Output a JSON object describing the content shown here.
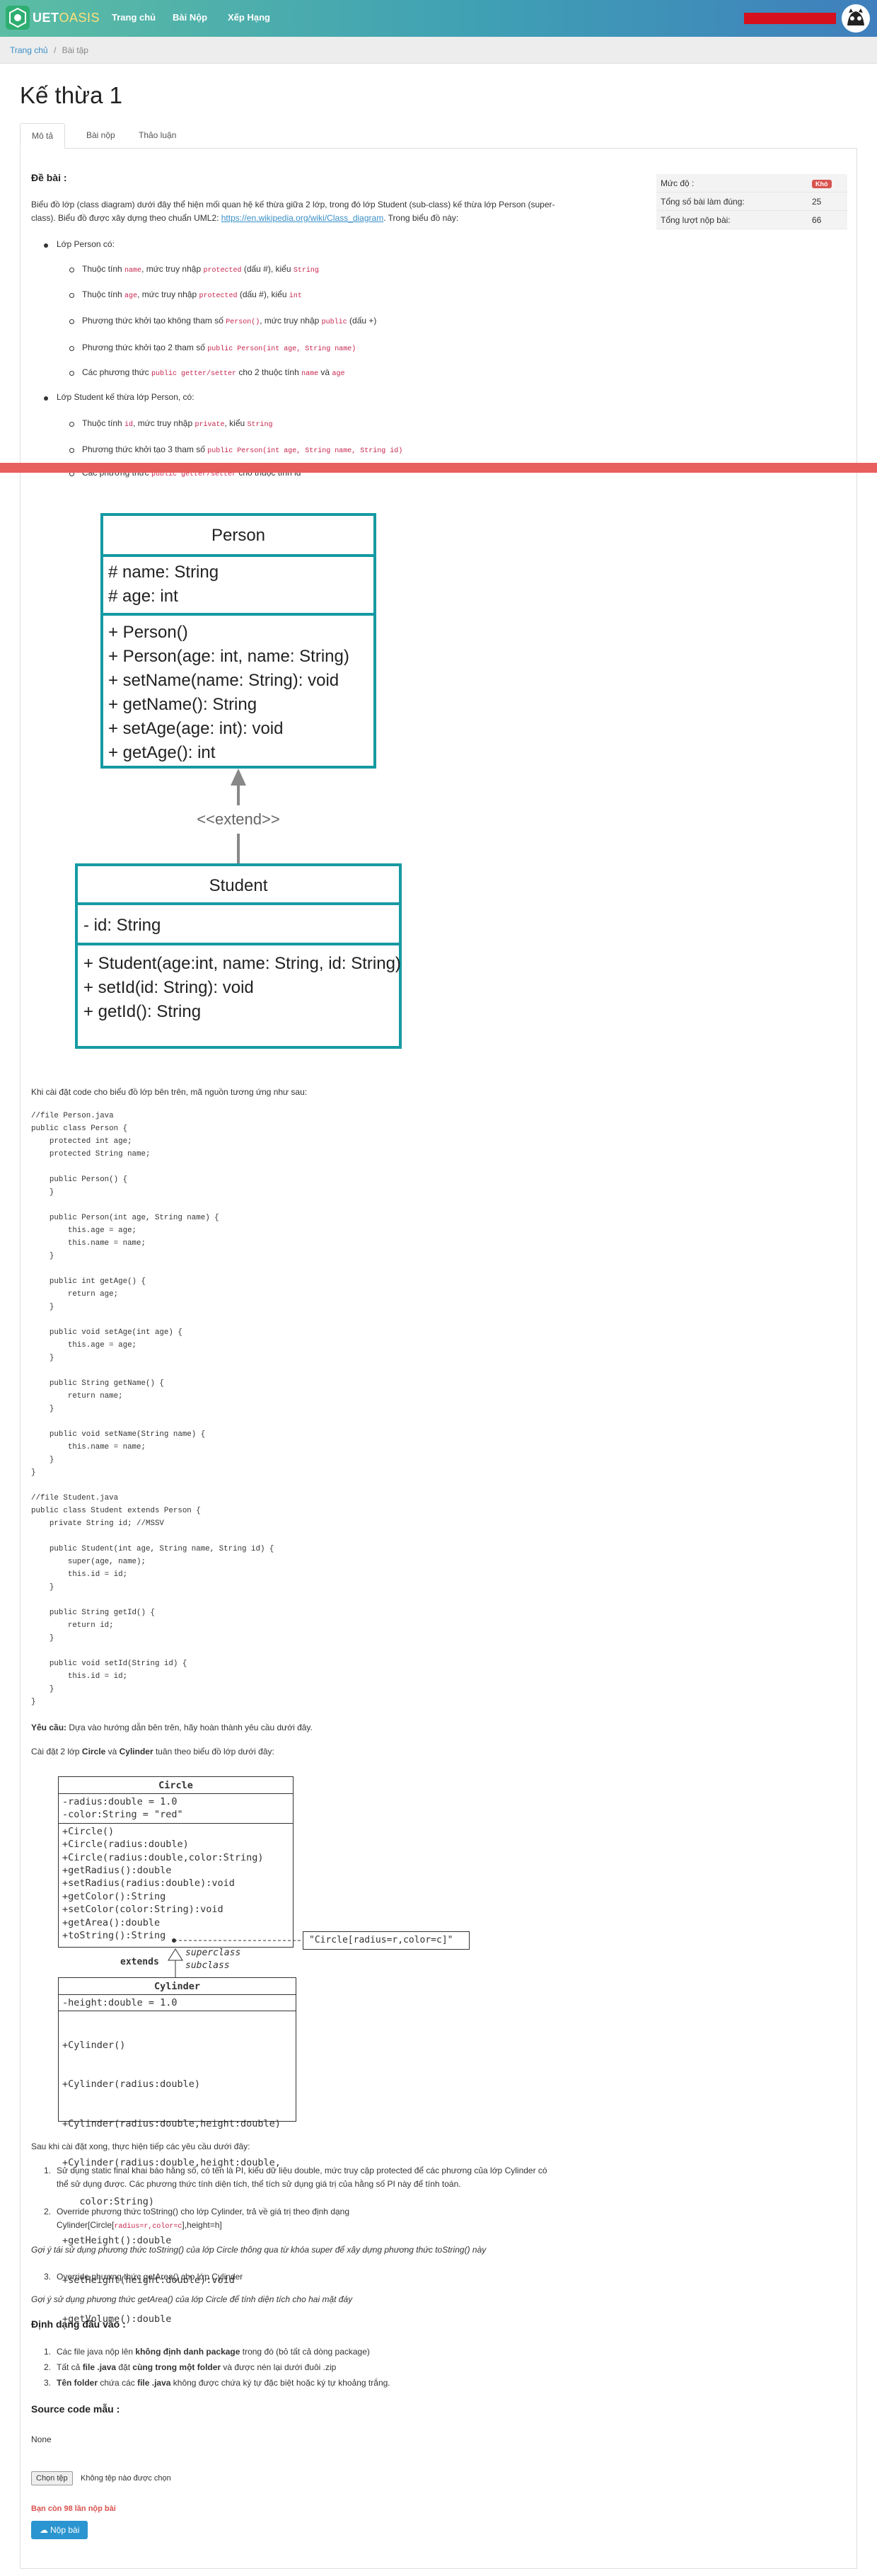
{
  "header": {
    "brand_a": "UET",
    "brand_b": "OASIS",
    "nav": [
      "Trang chủ",
      "Bài Nộp",
      "Xếp Hạng"
    ]
  },
  "breadcrumb": {
    "home": "Trang chủ",
    "sep": "/",
    "current": "Bài tập"
  },
  "page_title": "Kế thừa 1",
  "tabs": [
    "Mô tả",
    "Bài nộp",
    "Thảo luận"
  ],
  "info": {
    "rows": [
      {
        "label": "Mức độ :",
        "value": "Khó"
      },
      {
        "label": "Tổng số bài làm đúng:",
        "value": "25"
      },
      {
        "label": "Tổng lượt nộp bài:",
        "value": "66"
      }
    ]
  },
  "content": {
    "heading": "Đề bài :",
    "intro_a": "Biểu đồ lớp (class diagram) dưới đây thể hiện mối quan hệ kế thừa giữa 2 lớp, trong đó lớp Student (sub-class) kế thừa lớp Person (super-",
    "intro_b": "class). Biểu đồ được xây dựng theo chuẩn UML2:",
    "intro_link": "https://en.wikipedia.org/wiki/Class_diagram",
    "intro_c": ". Trong biểu đồ này:",
    "person_title": "Lớp Person có:",
    "p1_a": "Thuộc tính ",
    "p1_code1": "name",
    "p1_b": ", mức truy nhập ",
    "p1_code2": "protected",
    "p1_c": " (dấu #), kiểu ",
    "p1_code3": "String",
    "p2_a": "Thuộc tính ",
    "p2_code1": "age",
    "p2_b": ", mức truy nhập ",
    "p2_code2": "protected",
    "p2_c": " (dấu #), kiểu ",
    "p2_code3": "int",
    "p3_a": "Phương thức khởi tạo không tham số ",
    "p3_code1": "Person()",
    "p3_b": ", mức truy nhập ",
    "p3_code2": "public",
    "p3_c": " (dấu +)",
    "p4_a": "Phương thức khởi tạo 2 tham số ",
    "p4_code1": "public Person(int age, String name)",
    "p5_a": "Các phương thức ",
    "p5_code1": "public getter/setter",
    "p5_b": " cho 2 thuộc tính ",
    "p5_code2": "name",
    "p5_c": " và ",
    "p5_code3": "age",
    "student_title": "Lớp Student kế thừa lớp Person, có:",
    "s1_a": "Thuộc tính ",
    "s1_code1": "id",
    "s1_b": ", mức truy nhập ",
    "s1_code2": "private",
    "s1_c": ", kiểu ",
    "s1_code3": "String",
    "s2_a": "Phương thức khởi tạo 3 tham số ",
    "s2_code1": "public Person(int age, String name, String id)",
    "s3_a": "Các phương thức ",
    "s3_code1": "public getter/setter",
    "s3_b": " cho thuộc tính id"
  },
  "uml1": {
    "person": {
      "name": "Person",
      "attrs": [
        "# name: String",
        "# age: int"
      ],
      "methods": [
        "+ Person()",
        "+ Person(age: int, name: String)",
        "+ setName(name: String): void",
        "+ getName(): String",
        "+ setAge(age: int): void",
        "+ getAge(): int"
      ]
    },
    "extend": "<<extend>>",
    "student": {
      "name": "Student",
      "attrs": [
        "- id: String"
      ],
      "methods": [
        "+ Student(age:int, name: String, id: String)",
        "+ setId(id: String): void",
        "+ getId(): String"
      ]
    }
  },
  "code_intro": "Khi cài đặt code cho biểu đồ lớp bên trên, mã nguồn tương ứng như sau:",
  "source_code": "//file Person.java\npublic class Person {\n    protected int age;\n    protected String name;\n\n    public Person() {\n    }\n\n    public Person(int age, String name) {\n        this.age = age;\n        this.name = name;\n    }\n\n    public int getAge() {\n        return age;\n    }\n\n    public void setAge(int age) {\n        this.age = age;\n    }\n\n    public String getName() {\n        return name;\n    }\n\n    public void setName(String name) {\n        this.name = name;\n    }\n}\n\n//file Student.java\npublic class Student extends Person {\n    private String id; //MSSV\n\n    public Student(int age, String name, String id) {\n        super(age, name);\n        this.id = id;\n    }\n\n    public String getId() {\n        return id;\n    }\n\n    public void setId(String id) {\n        this.id = id;\n    }\n}",
  "req": {
    "label": "Yêu cầu:",
    "text": " Dựa vào hướng dẫn bên trên, hãy hoàn thành yêu cầu dưới đây.",
    "l2_a": "Cài đặt 2 lớp ",
    "l2_b1": "Circle",
    "l2_c": " và ",
    "l2_b2": "Cylinder",
    "l2_d": " tuân theo biểu đồ lớp dưới đây:"
  },
  "uml2": {
    "circle": {
      "name": "Circle",
      "attrs": [
        "-radius:double = 1.0",
        "-color:String = \"red\""
      ],
      "methods": [
        "+Circle()",
        "+Circle(radius:double)",
        "+Circle(radius:double,color:String)",
        "+getRadius():double",
        "+setRadius(radius:double):void",
        "+getColor():String",
        "+setColor(color:String):void",
        "+getArea():double",
        "+toString():String"
      ]
    },
    "note": "\"Circle[radius=r,color=c]\"",
    "extends": "extends",
    "superclass": "superclass",
    "subclass": "subclass",
    "cylinder": {
      "name": "Cylinder",
      "attrs": [
        "-height:double = 1.0"
      ],
      "methods": [
        "+Cylinder()",
        "+Cylinder(radius:double)",
        "+Cylinder(radius:double,height:double)",
        "+Cylinder(radius:double,height:double,",
        "   color:String)",
        "+getHeight():double",
        "+setHeight(height:double):void",
        "+getVolume():double"
      ]
    }
  },
  "after": {
    "intro": "Sau khi cài đặt xong, thực hiện tiếp các yêu cầu dưới đây:",
    "i1": "Sử dụng static final khai báo hằng số, có tên là PI, kiểu dữ liệu double, mức truy cập protected để các phương của lớp Cylinder có",
    "i1b": "thể sử dụng được. Các phương thức tính diện tích, thể tích sử dụng giá trị của hằng số PI này để tính toán.",
    "i2": "Override phương thức toString() cho lớp Cylinder, trả về giá trị theo định dạng",
    "i2b_a": "Cylinder[Circle[",
    "i2b_code": "radius=r,color=c",
    "i2b_b": "],height=h]",
    "hint1": "Gợi ý tái sử dụng phương thức toString() của lớp Circle thông qua từ khóa super để xây dựng phương thức toString() này",
    "i3": "Override phương thức getArea() cho lớp Cylinder",
    "hint2": "Gợi ý sử dụng phương thức getArea() của lớp Circle để tính diện tích cho hai mặt đáy"
  },
  "format": {
    "heading": "Định dạng đầu vào :",
    "f1_a": "Các file java nộp lên ",
    "f1_b": "không định danh package",
    "f1_c": " trong đó (bỏ tất cả dòng package)",
    "f2_a": "Tất cả ",
    "f2_b": "file .java",
    "f2_c": " đặt ",
    "f2_d": "cùng trong một folder",
    "f2_e": " và được nén lại dưới đuôi .zip",
    "f3_a": "Tên folder",
    "f3_b": " chứa các ",
    "f3_c": "file .java",
    "f3_d": " không được chứa ký tự đặc biệt hoặc ký tự khoảng trắng."
  },
  "source": {
    "heading": "Source code mẫu :",
    "value": "None"
  },
  "upload": {
    "button": "Chọn tệp",
    "status": "Không tệp nào được chọn",
    "remaining": "Bạn còn 98 lần nộp bài",
    "submit": "Nộp bài"
  }
}
